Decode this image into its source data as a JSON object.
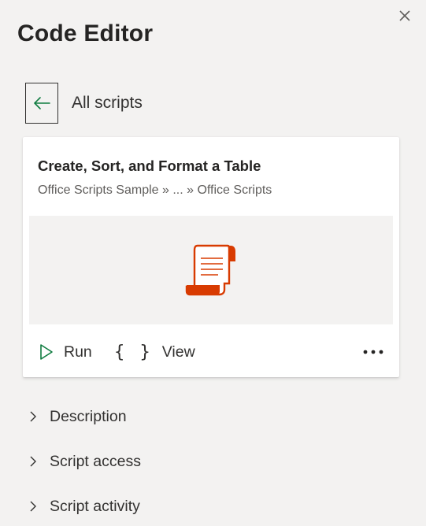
{
  "pane": {
    "title": "Code Editor",
    "close_label": "×"
  },
  "nav": {
    "back_label": "All scripts"
  },
  "script_card": {
    "title": "Create, Sort, and Format a Table",
    "path": "Office Scripts Sample » ... » Office Scripts",
    "icon": "script-scroll-icon",
    "actions": {
      "run_label": "Run",
      "view_label": "View",
      "view_icon_glyph": "{ }",
      "more_label": "•••"
    }
  },
  "sections": [
    {
      "label": "Description"
    },
    {
      "label": "Script access"
    },
    {
      "label": "Script activity"
    }
  ],
  "colors": {
    "background": "#f3f2f1",
    "card": "#ffffff",
    "accent_run": "#107c41",
    "script_icon": "#d83b01",
    "text": "#323130"
  }
}
